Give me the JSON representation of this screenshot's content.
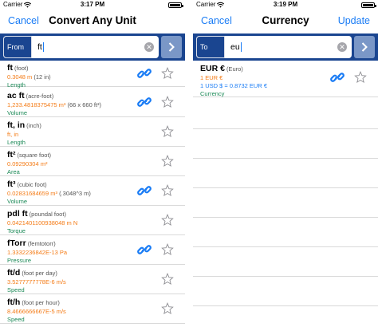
{
  "left": {
    "status": {
      "carrier": "Carrier",
      "time": "3:17 PM"
    },
    "nav": {
      "cancel": "Cancel",
      "title": "Convert Any Unit"
    },
    "search": {
      "prefix": "From",
      "value": "ft"
    },
    "rows": [
      {
        "symbol": "ft",
        "name": "(foot)",
        "value": "0.3048 m",
        "extra": "(12 in)",
        "category": "Length",
        "link": true
      },
      {
        "symbol": "ac ft",
        "name": "(acre-foot)",
        "value": "1,233.4818375475 m³",
        "extra": "(66 x 660 ft³)",
        "category": "Volume",
        "link": true
      },
      {
        "symbol": "ft, in",
        "name": "(inch)",
        "value": "ft, in",
        "extra": "",
        "category": "Length",
        "link": false
      },
      {
        "symbol": "ft²",
        "name": "(square foot)",
        "value": "0.09290304 m²",
        "extra": "",
        "category": "Area",
        "link": false
      },
      {
        "symbol": "ft³",
        "name": "(cubic foot)",
        "value": "0.02831684659 m³",
        "extra": "(.3048^3 m)",
        "category": "Volume",
        "link": true
      },
      {
        "symbol": "pdl ft",
        "name": "(poundal foot)",
        "value": "0.0421401100938048 m N",
        "extra": "",
        "category": "Torque",
        "link": false
      },
      {
        "symbol": "fTorr",
        "name": "(femtotorr)",
        "value": "1.3332236842E-13 Pa",
        "extra": "",
        "category": "Pressure",
        "link": true
      },
      {
        "symbol": "ft/d",
        "name": "(foot per day)",
        "value": "3.5277777778E-6 m/s",
        "extra": "",
        "category": "Speed",
        "link": false
      },
      {
        "symbol": "ft/h",
        "name": "(foot per hour)",
        "value": "8.4666666667E-5 m/s",
        "extra": "",
        "category": "Speed",
        "link": false
      }
    ]
  },
  "right": {
    "status": {
      "carrier": "Carrier",
      "time": "3:19 PM"
    },
    "nav": {
      "cancel": "Cancel",
      "title": "Currency",
      "update": "Update"
    },
    "search": {
      "prefix": "To",
      "value": "eu"
    },
    "result": {
      "symbol": "EUR €",
      "name": "(Euro)",
      "value1": "1 EUR €",
      "value2": "1 USD $ = 0.8732 EUR €",
      "category": "Currency"
    }
  },
  "colors": {
    "accent": "#1a7cf5",
    "bar": "#1a4590",
    "value": "#f47b16",
    "category": "#1d8a58"
  },
  "icons": {
    "link": "link-icon",
    "star": "star-icon",
    "clear": "clear-icon",
    "go": "chevron-right-icon"
  }
}
